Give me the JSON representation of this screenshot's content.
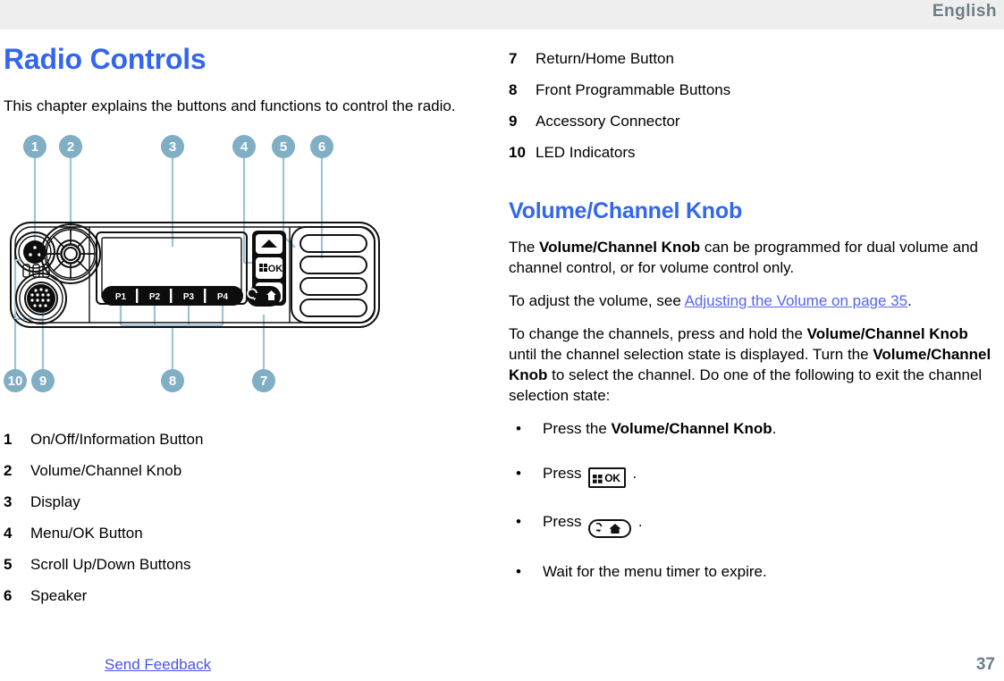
{
  "header": {
    "language": "English"
  },
  "left": {
    "chapter_title": "Radio Controls",
    "intro": "This chapter explains the buttons and functions to control the radio.",
    "legend": [
      {
        "num": "1",
        "label": "On/Off/Information Button"
      },
      {
        "num": "2",
        "label": "Volume/Channel Knob"
      },
      {
        "num": "3",
        "label": "Display"
      },
      {
        "num": "4",
        "label": "Menu/OK Button"
      },
      {
        "num": "5",
        "label": "Scroll Up/Down Buttons"
      },
      {
        "num": "6",
        "label": "Speaker"
      }
    ],
    "diagram": {
      "alt": "front view of mobile radio with numbered callouts",
      "callouts_top": [
        "1",
        "2",
        "3",
        "4",
        "5",
        "6"
      ],
      "callouts_bottom": [
        "10",
        "9",
        "8",
        "7"
      ],
      "button_labels": [
        "P1",
        "P2",
        "P3",
        "P4"
      ],
      "ok_label": "OK",
      "callout_color": "#80aec4"
    }
  },
  "right": {
    "legend": [
      {
        "num": "7",
        "label": "Return/Home Button"
      },
      {
        "num": "8",
        "label": "Front Programmable Buttons"
      },
      {
        "num": "9",
        "label": "Accessory Connector"
      },
      {
        "num": "10",
        "label": "LED Indicators"
      }
    ],
    "section_title": "Volume/Channel Knob",
    "para1_a": "The ",
    "para1_b": "Volume/Channel Knob",
    "para1_c": " can be programmed for dual volume and channel control, or for volume control only.",
    "para2_a": "To adjust the volume, see ",
    "para2_link": "Adjusting the Volume on page 35",
    "para2_b": ".",
    "para3_a": "To change the channels, press and hold the ",
    "para3_b": "Volume/Channel Knob",
    "para3_c": " until the channel selection state is displayed. Turn the ",
    "para3_d": "Volume/Channel Knob",
    "para3_e": " to select the channel. Do one of the following to exit the channel selection state:",
    "bullets": [
      {
        "pre": "Press the ",
        "bold": "Volume/Channel Knob",
        "post": ".",
        "icon": ""
      },
      {
        "pre": "Press ",
        "bold": "",
        "post": " .",
        "icon": "menu-ok-key-icon",
        "icon_text": "OK"
      },
      {
        "pre": "Press ",
        "bold": "",
        "post": " .",
        "icon": "return-home-key-icon"
      },
      {
        "pre": "Wait for the menu timer to expire.",
        "bold": "",
        "post": "",
        "icon": ""
      }
    ]
  },
  "footer": {
    "send_feedback": "Send Feedback",
    "page_number": "37"
  },
  "colors": {
    "heading_blue": "#3366ee",
    "link_blue": "#5566ee",
    "callout_blue": "#80aec4",
    "header_gray": "#6a7f85",
    "band_bg": "#eeeeee"
  }
}
